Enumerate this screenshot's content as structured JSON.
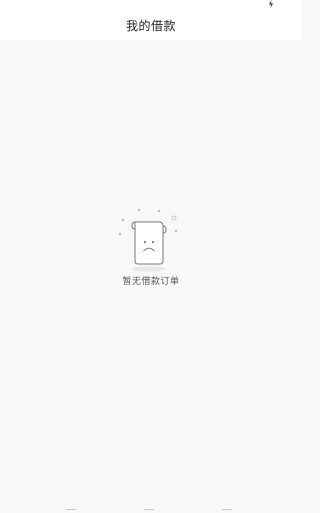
{
  "status_bar": {
    "icon": "lightning-icon"
  },
  "nav": {
    "title": "我的借款"
  },
  "empty_state": {
    "illustration_icon": "sad-receipt-icon",
    "message": "暂无借款订单"
  },
  "bottom_tabs": {
    "icons": [
      "tab-icon",
      "tab-icon",
      "tab-icon"
    ]
  }
}
